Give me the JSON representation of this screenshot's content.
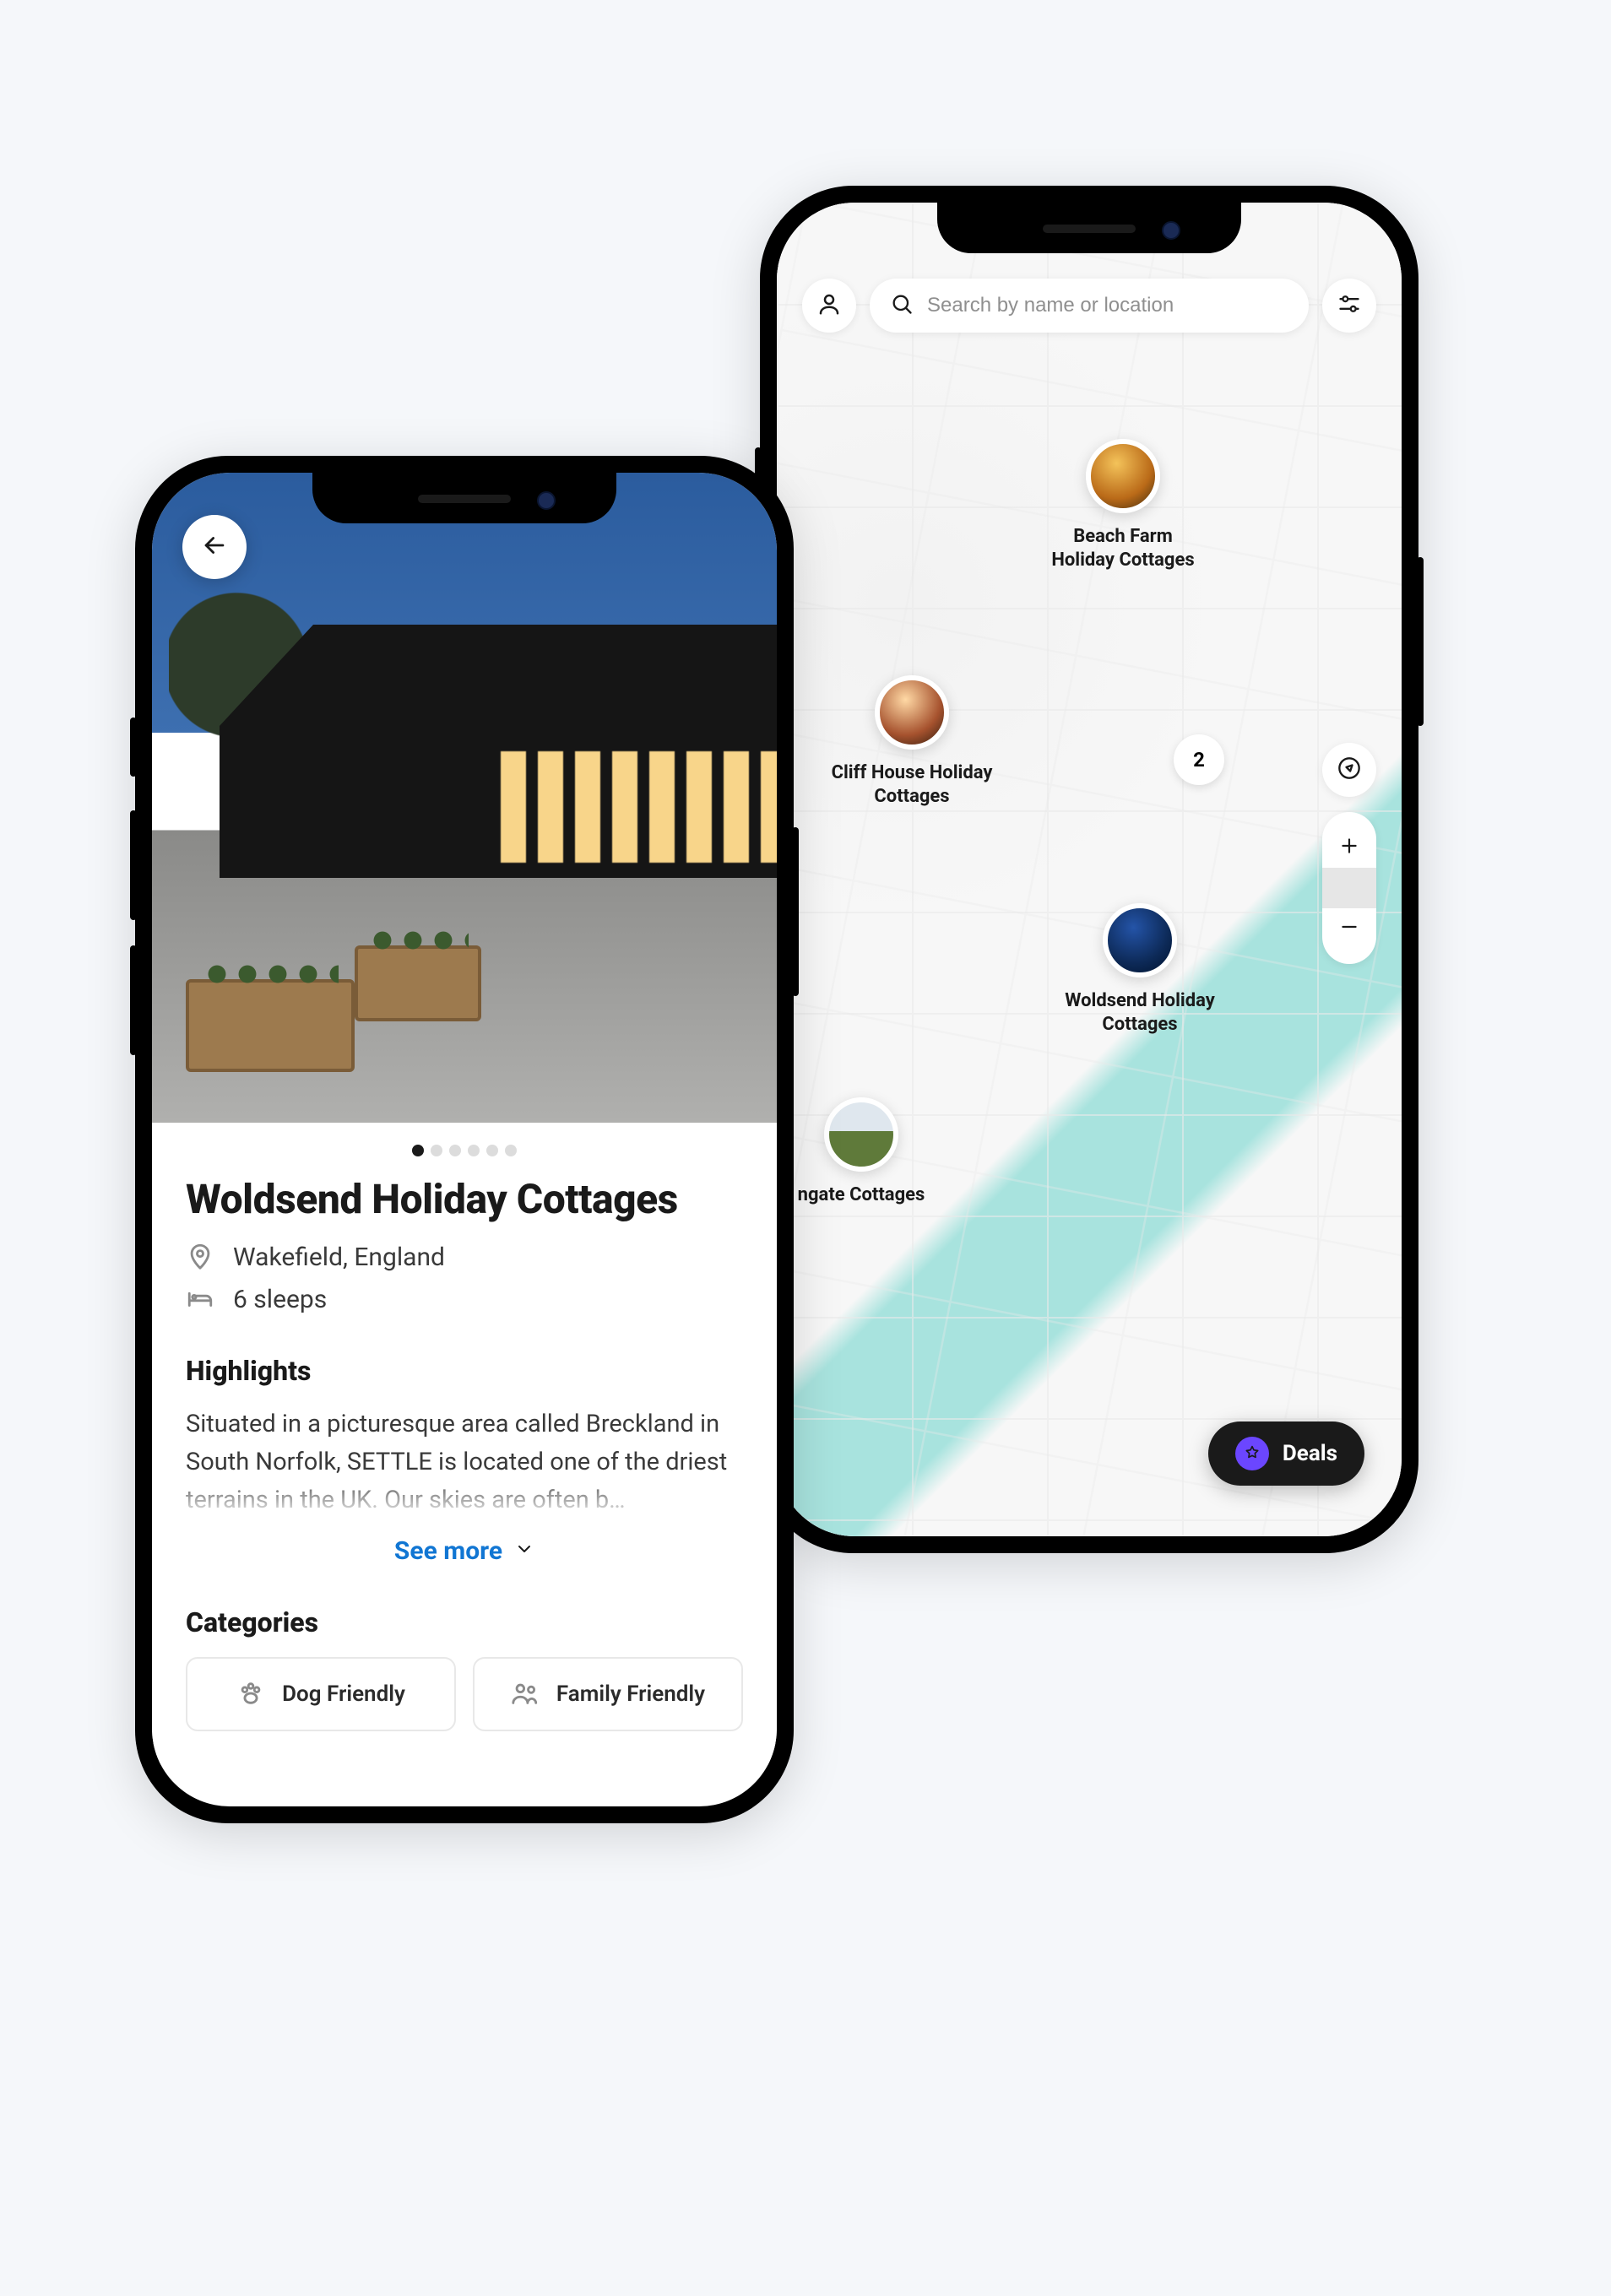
{
  "map": {
    "search_placeholder": "Search by name or location",
    "pins": [
      {
        "id": "beach",
        "label": "Beach Farm\nHoliday Cottages"
      },
      {
        "id": "cliff",
        "label": "Cliff House Holiday\nCottages"
      },
      {
        "id": "wold",
        "label": "Woldsend Holiday\nCottages"
      },
      {
        "id": "gate",
        "label": "ngate Cottages"
      }
    ],
    "cluster_count": "2",
    "deals_label": "Deals"
  },
  "detail": {
    "title": "Woldsend Holiday Cottages",
    "location": "Wakefield, England",
    "sleeps": "6 sleeps",
    "highlights_heading": "Highlights",
    "description": "Situated in a picturesque area called Breckland in South Norfolk, SETTLE is located one of the driest terrains in the UK. Our skies are often b…",
    "see_more_label": "See more",
    "categories_heading": "Categories",
    "categories": [
      {
        "id": "dog",
        "label": "Dog Friendly"
      },
      {
        "id": "family",
        "label": "Family Friendly"
      }
    ],
    "carousel_total": 6,
    "carousel_active": 1
  }
}
